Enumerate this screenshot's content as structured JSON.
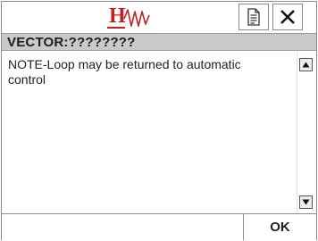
{
  "toolbar": {
    "logo_letter": "H",
    "logo_icon": "honeywell-wave-logo",
    "doc_button_icon": "document-icon",
    "close_button_icon": "close-icon"
  },
  "header": {
    "title": "VECTOR:????????"
  },
  "message": {
    "text": "NOTE-Loop may be returned to automatic control"
  },
  "scrollbar": {
    "up_icon": "triangle-up-icon",
    "down_icon": "triangle-down-icon"
  },
  "footer": {
    "ok_label": "OK"
  },
  "colors": {
    "logo_red": "#c31f24",
    "header_bg": "#c9c9c9",
    "border": "#8c8c8c"
  }
}
